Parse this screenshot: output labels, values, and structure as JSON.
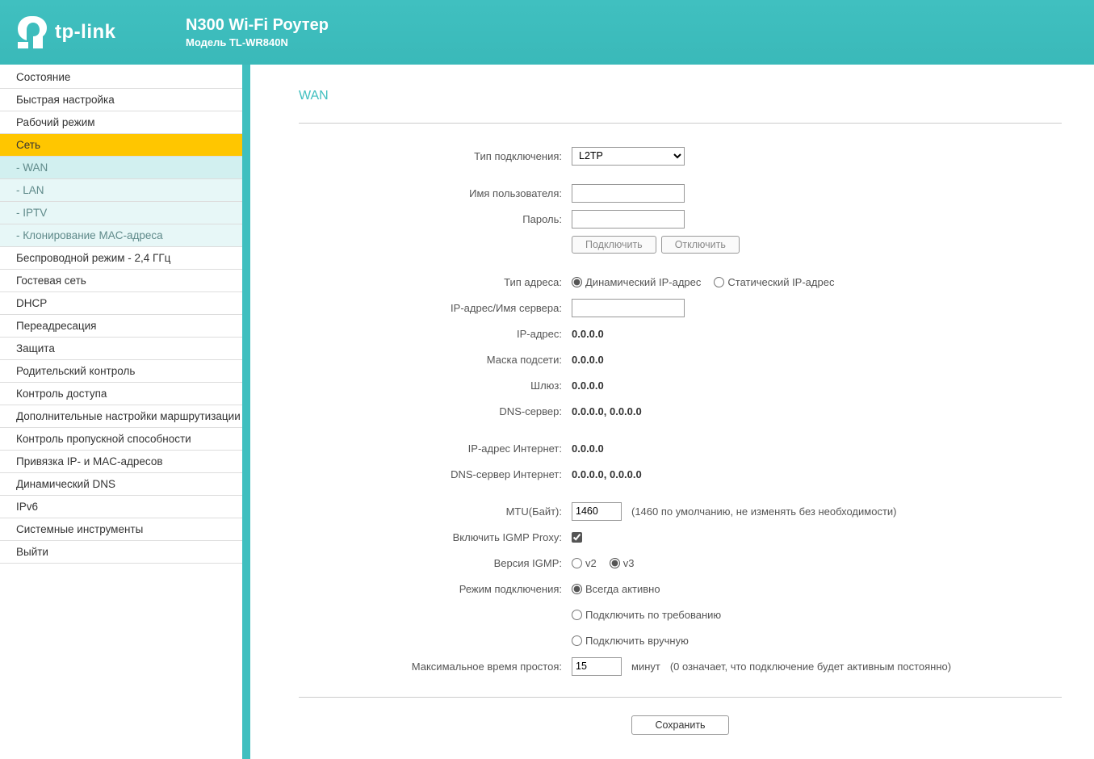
{
  "header": {
    "brand": "tp-link",
    "title": "N300 Wi-Fi Роутер",
    "model": "Модель TL-WR840N"
  },
  "nav": [
    {
      "label": "Состояние",
      "type": "item"
    },
    {
      "label": "Быстрая настройка",
      "type": "item"
    },
    {
      "label": "Рабочий режим",
      "type": "item"
    },
    {
      "label": "Сеть",
      "type": "active"
    },
    {
      "label": "- WAN",
      "type": "sub-selected"
    },
    {
      "label": "- LAN",
      "type": "sub"
    },
    {
      "label": "- IPTV",
      "type": "sub"
    },
    {
      "label": "- Клонирование MAC-адреса",
      "type": "sub"
    },
    {
      "label": "Беспроводной режим - 2,4 ГГц",
      "type": "item"
    },
    {
      "label": "Гостевая сеть",
      "type": "item"
    },
    {
      "label": "DHCP",
      "type": "item"
    },
    {
      "label": "Переадресация",
      "type": "item"
    },
    {
      "label": "Защита",
      "type": "item"
    },
    {
      "label": "Родительский контроль",
      "type": "item"
    },
    {
      "label": "Контроль доступа",
      "type": "item"
    },
    {
      "label": "Дополнительные настройки маршрутизации",
      "type": "item"
    },
    {
      "label": "Контроль пропускной способности",
      "type": "item"
    },
    {
      "label": "Привязка IP- и MAC-адресов",
      "type": "item"
    },
    {
      "label": "Динамический DNS",
      "type": "item"
    },
    {
      "label": "IPv6",
      "type": "item"
    },
    {
      "label": "Системные инструменты",
      "type": "item"
    },
    {
      "label": "Выйти",
      "type": "item"
    }
  ],
  "page": {
    "title": "WAN",
    "labels": {
      "connection_type": "Тип подключения:",
      "username": "Имя пользователя:",
      "password": "Пароль:",
      "address_type": "Тип адреса:",
      "server_ip": "IP-адрес/Имя сервера:",
      "ip_address": "IP-адрес:",
      "subnet": "Маска подсети:",
      "gateway": "Шлюз:",
      "dns": "DNS-сервер:",
      "inet_ip": "IP-адрес Интернет:",
      "inet_dns": "DNS-сервер Интернет:",
      "mtu": "MTU(Байт):",
      "igmp_proxy": "Включить IGMP Proxy:",
      "igmp_ver": "Версия IGMP:",
      "conn_mode": "Режим подключения:",
      "idle": "Максимальное время простоя:"
    },
    "values": {
      "connection_type": "L2TP",
      "username": "",
      "password": "",
      "server_ip": "",
      "ip_address": "0.0.0.0",
      "subnet": "0.0.0.0",
      "gateway": "0.0.0.0",
      "dns": "0.0.0.0,   0.0.0.0",
      "inet_ip": "0.0.0.0",
      "inet_dns": "0.0.0.0,   0.0.0.0",
      "mtu": "1460",
      "idle": "15"
    },
    "buttons": {
      "connect": "Подключить",
      "disconnect": "Отключить",
      "save": "Сохранить"
    },
    "radios": {
      "addr_dynamic": "Динамический IP-адрес",
      "addr_static": "Статический IP-адрес",
      "igmp_v2": "v2",
      "igmp_v3": "v3",
      "mode_always": "Всегда активно",
      "mode_demand": "Подключить по требованию",
      "mode_manual": "Подключить вручную"
    },
    "hints": {
      "mtu": "(1460 по умолчанию, не изменять без необходимости)",
      "idle_unit": "минут",
      "idle_note": "(0 означает, что подключение будет активным постоянно)"
    }
  }
}
